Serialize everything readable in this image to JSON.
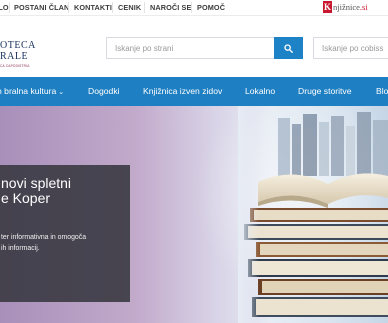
{
  "topbar": {
    "links": [
      {
        "label": "ALO"
      },
      {
        "label": "POSTANI ČLAN"
      },
      {
        "label": "KONTAKTI"
      },
      {
        "label": "CENIK"
      },
      {
        "label": "NAROČI SE"
      },
      {
        "label": "POMOČ"
      }
    ],
    "knjiznice_logo": {
      "k": "K",
      "text": "njižnice",
      "suffix": ".si"
    }
  },
  "brand": {
    "line1": "OTECA",
    "line2": "RALE",
    "line3": "CA CAPODISTRIA"
  },
  "search": {
    "catalog_placeholder": "Iskanje po strani",
    "button_icon": "search-icon",
    "cobiss_placeholder": "Iskanje po cobiss"
  },
  "nav": {
    "items": [
      {
        "label": "n bralna kultura",
        "dropdown": true
      },
      {
        "label": "Dogodki"
      },
      {
        "label": "Knjižnica izven zidov"
      },
      {
        "label": "Lokalno"
      },
      {
        "label": "Druge storitve"
      },
      {
        "label": "Blo"
      }
    ],
    "color": "#1e7fc2"
  },
  "hero": {
    "title_line1": "novi spletni",
    "title_line2": "e Koper",
    "text_line1": "ter informativna in omogoča",
    "text_line2": "ih informacij."
  },
  "colors": {
    "accent": "#1e83c6",
    "brand": "#19335f",
    "knjiznice_red": "#c8172e"
  }
}
